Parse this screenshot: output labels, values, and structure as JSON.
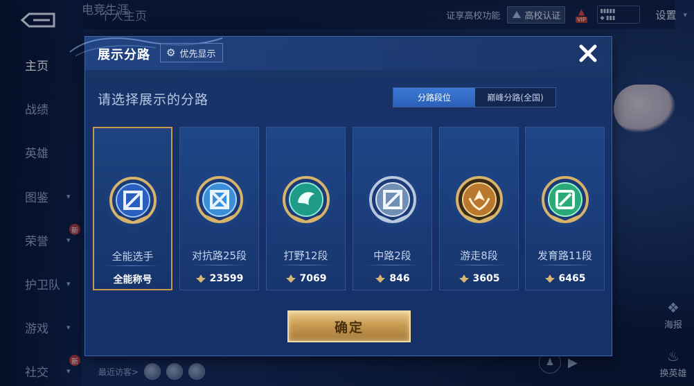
{
  "nav": {
    "items": [
      {
        "label": "主页",
        "active": true,
        "chevron": false,
        "badge": ""
      },
      {
        "label": "战绩",
        "active": false,
        "chevron": false,
        "badge": ""
      },
      {
        "label": "英雄",
        "active": false,
        "chevron": false,
        "badge": ""
      },
      {
        "label": "图鉴",
        "active": false,
        "chevron": true,
        "badge": ""
      },
      {
        "label": "荣誉",
        "active": false,
        "chevron": true,
        "badge": "新"
      },
      {
        "label": "护卫队",
        "active": false,
        "chevron": true,
        "badge": ""
      },
      {
        "label": "游戏",
        "active": false,
        "chevron": true,
        "badge": ""
      },
      {
        "label": "社交",
        "active": false,
        "chevron": true,
        "badge": "新"
      }
    ]
  },
  "top": {
    "tab_profile": "个人主页",
    "tab_career": "电竞生涯",
    "campus_hint": "证享高校功能",
    "campus_button": "高校认证",
    "vip": "VIP",
    "settings": "设置"
  },
  "bottom": {
    "recent_visitors": "最近访客>",
    "poster": "海报",
    "change_hero": "换英雄"
  },
  "modal": {
    "title": "展示分路",
    "priority_button": "优先显示",
    "subtitle": "请选择展示的分路",
    "seg_options": [
      "分路段位",
      "巅峰分路(全国)"
    ],
    "confirm": "确定",
    "cards": [
      {
        "label": "全能选手",
        "foot": "全能称号",
        "selected": true,
        "show_icon": false,
        "emblem": "all-round-emblem-icon",
        "color": "#5b8ee0"
      },
      {
        "label": "对抗路25段",
        "foot": "23599",
        "selected": false,
        "show_icon": true,
        "emblem": "clash-lane-emblem-icon",
        "color": "#4aa3e8"
      },
      {
        "label": "打野12段",
        "foot": "7069",
        "selected": false,
        "show_icon": true,
        "emblem": "jungle-emblem-icon",
        "color": "#2fb7a0"
      },
      {
        "label": "中路2段",
        "foot": "846",
        "selected": false,
        "show_icon": true,
        "emblem": "mid-lane-emblem-icon",
        "color": "#8aa6c8"
      },
      {
        "label": "游走8段",
        "foot": "3605",
        "selected": false,
        "show_icon": true,
        "emblem": "roam-emblem-icon",
        "color": "#c9883e"
      },
      {
        "label": "发育路11段",
        "foot": "6465",
        "selected": false,
        "show_icon": true,
        "emblem": "farm-lane-emblem-icon",
        "color": "#3ec08e"
      }
    ]
  }
}
